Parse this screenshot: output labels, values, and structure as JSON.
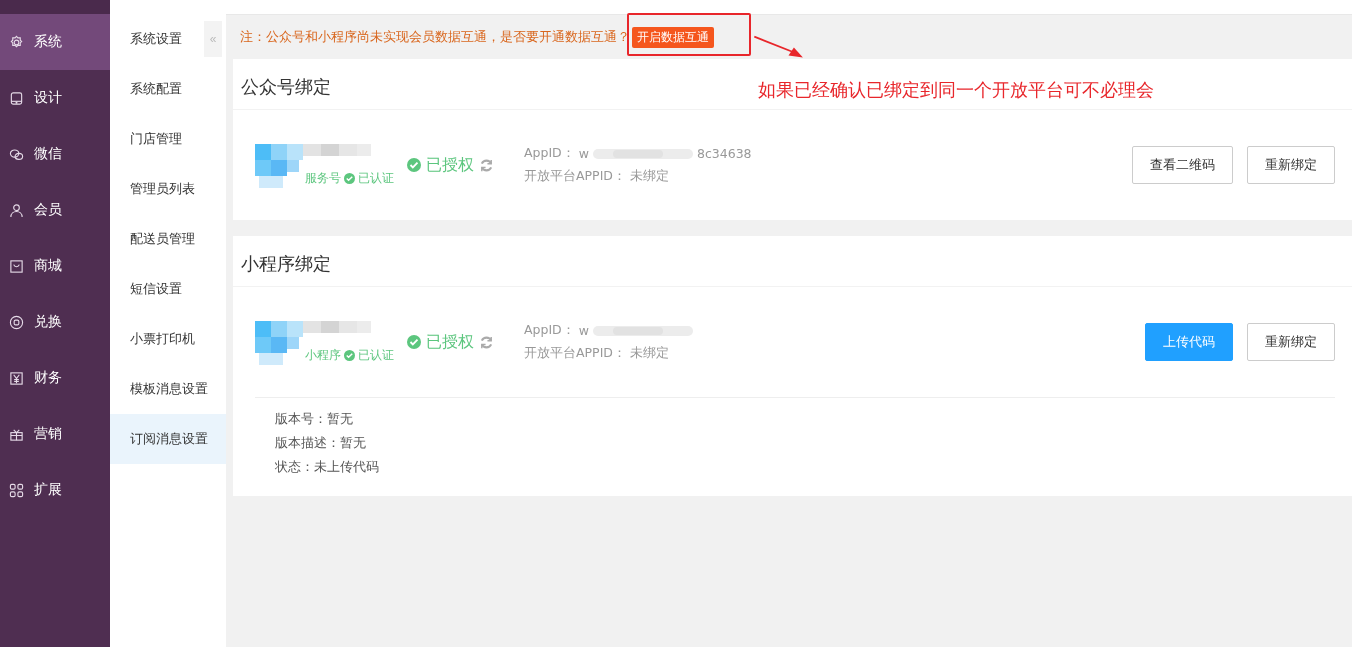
{
  "main_nav": [
    {
      "label": "系统",
      "kind": "gear",
      "selected": true
    },
    {
      "label": "设计",
      "kind": "tablet",
      "selected": false
    },
    {
      "label": "微信",
      "kind": "chat",
      "selected": false
    },
    {
      "label": "会员",
      "kind": "user",
      "selected": false
    },
    {
      "label": "商城",
      "kind": "bag",
      "selected": false
    },
    {
      "label": "兑换",
      "kind": "coin",
      "selected": false
    },
    {
      "label": "财务",
      "kind": "yen",
      "selected": false
    },
    {
      "label": "营销",
      "kind": "gift",
      "selected": false
    },
    {
      "label": "扩展",
      "kind": "grid",
      "selected": false
    }
  ],
  "sub_nav": {
    "title": "系统设置",
    "collapse": "«",
    "items": [
      {
        "label": "系统配置",
        "selected": false
      },
      {
        "label": "门店管理",
        "selected": false
      },
      {
        "label": "管理员列表",
        "selected": false
      },
      {
        "label": "配送员管理",
        "selected": false
      },
      {
        "label": "短信设置",
        "selected": false
      },
      {
        "label": "小票打印机",
        "selected": false
      },
      {
        "label": "模板消息设置",
        "selected": false
      },
      {
        "label": "订阅消息设置",
        "selected": true
      }
    ]
  },
  "notice": {
    "text": "注：公众号和小程序尚未实现会员数据互通，是否要开通数据互通？",
    "button": "开启数据互通"
  },
  "annotation": "如果已经确认已绑定到同一个开放平台可不必理会",
  "cards": [
    {
      "title": "公众号绑定",
      "type_label": "服务号",
      "verified": "已认证",
      "authorized": "已授权",
      "appid_label": "AppID：",
      "appid_start": "w",
      "appid_end": "8c34638",
      "open_label": "开放平台APPID：",
      "open_value": "未绑定",
      "buttons": [
        {
          "label": "查看二维码",
          "primary": false
        },
        {
          "label": "重新绑定",
          "primary": false
        }
      ]
    },
    {
      "title": "小程序绑定",
      "type_label": "小程序",
      "verified": "已认证",
      "authorized": "已授权",
      "appid_label": "AppID：",
      "appid_start": "w",
      "open_label": "开放平台APPID：",
      "open_value": "未绑定",
      "buttons": [
        {
          "label": "上传代码",
          "primary": true
        },
        {
          "label": "重新绑定",
          "primary": false
        }
      ],
      "details": [
        "版本号：暂无",
        "版本描述：暂无",
        "状态：未上传代码"
      ]
    }
  ]
}
